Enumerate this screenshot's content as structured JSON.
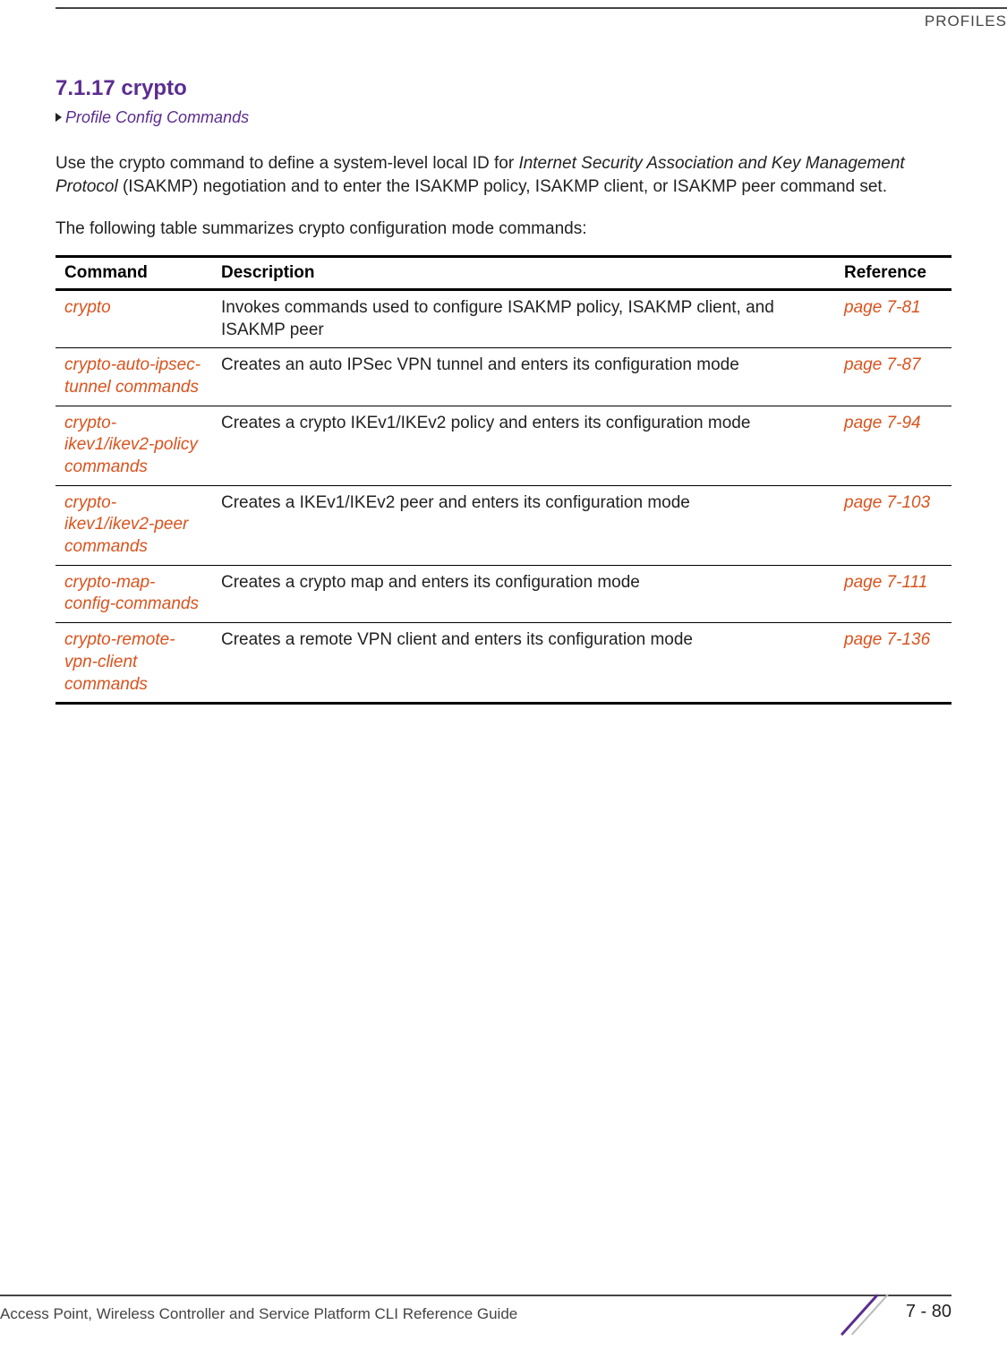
{
  "header": {
    "section_label": "PROFILES"
  },
  "section": {
    "number_title": "7.1.17 crypto",
    "breadcrumb": "Profile Config Commands"
  },
  "paragraphs": {
    "intro_part1": "Use the crypto command to define a system-level local ID for ",
    "intro_italic": "Internet Security Association and Key Management Protocol",
    "intro_part2": " (ISAKMP) negotiation and to enter the ISAKMP policy, ISAKMP client, or ISAKMP peer command set.",
    "lead": "The following table summarizes crypto configuration mode commands:"
  },
  "table": {
    "headers": {
      "command": "Command",
      "description": "Description",
      "reference": "Reference"
    },
    "rows": [
      {
        "command": "crypto",
        "description": "Invokes commands used to configure ISAKMP policy, ISAKMP client, and ISAKMP peer",
        "reference": "page 7-81"
      },
      {
        "command": "crypto-auto-ipsec-tunnel commands",
        "description": "Creates an auto IPSec VPN tunnel and enters its configuration mode",
        "reference": "page 7-87"
      },
      {
        "command": "crypto-ikev1/ikev2-policy commands",
        "description": "Creates a crypto IKEv1/IKEv2 policy and enters its configuration mode",
        "reference": "page 7-94"
      },
      {
        "command": "crypto-ikev1/ikev2-peer commands",
        "description": "Creates a IKEv1/IKEv2 peer and enters its configuration mode",
        "reference": "page 7-103"
      },
      {
        "command": "crypto-map-config-commands",
        "description": "Creates a crypto map and enters its configuration mode",
        "reference": "page 7-111"
      },
      {
        "command": "crypto-remote-vpn-client commands",
        "description": "Creates a remote VPN client and enters its configuration mode",
        "reference": "page 7-136"
      }
    ]
  },
  "footer": {
    "text": "Access Point, Wireless Controller and Service Platform CLI Reference Guide",
    "page": "7 - 80"
  }
}
